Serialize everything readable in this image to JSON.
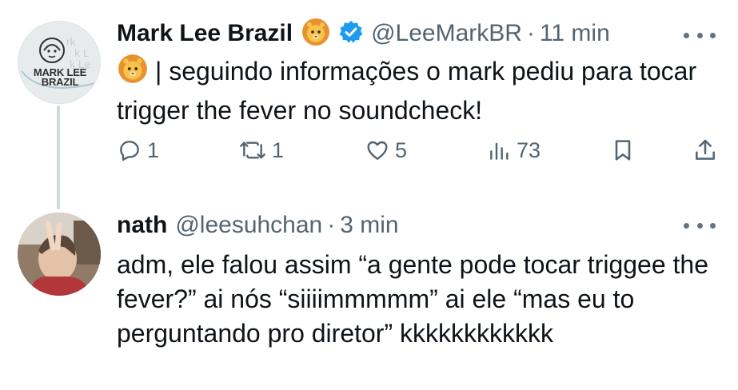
{
  "tweets": [
    {
      "author": {
        "name": "Mark Lee Brazil",
        "handle": "@LeeMarkBR",
        "avatar_logo_text": "MARK LEE\nBRAZIL",
        "verified": true,
        "badge_emoji": "lion-face"
      },
      "time": "11 min",
      "separator": "·",
      "body_prefix_emoji": "lion-face",
      "body": "| seguindo informações o mark pediu para tocar trigger the fever no soundcheck!",
      "actions": {
        "replies": "1",
        "retweets": "1",
        "likes": "5",
        "views": "73"
      }
    },
    {
      "author": {
        "name": "nath",
        "handle": "@leesuhchan"
      },
      "time": "3 min",
      "separator": "·",
      "body": "adm, ele falou assim “a gente pode tocar triggee the fever?” ai nós “siiiimmmmm” ai ele “mas eu to perguntando pro diretor” kkkkkkkkkkkk"
    }
  ],
  "colors": {
    "text_primary": "#0f1419",
    "text_secondary": "#536471",
    "verified_blue": "#1d9bf0",
    "thread_line": "#cfd9de"
  }
}
